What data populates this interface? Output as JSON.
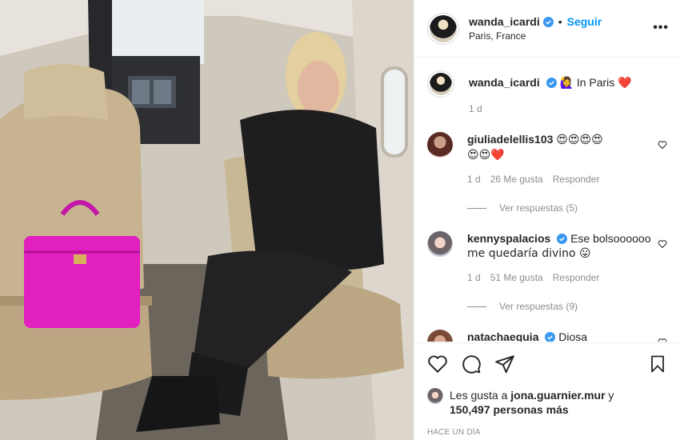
{
  "post": {
    "author": "wanda_icardi",
    "follow_label": "Seguir",
    "location": "Paris, France",
    "more_icon": "more-options-icon",
    "separator": "•"
  },
  "caption": {
    "username": "wanda_icardi",
    "emoji": "🙋‍♀️",
    "text": "In Paris",
    "heart": "❤️",
    "age": "1 d"
  },
  "comments": [
    {
      "username": "giuliadelellis103",
      "verified": false,
      "text": "😍😍😍😍",
      "text2": "😍😍❤️",
      "age": "1 d",
      "likes": "26 Me gusta",
      "reply": "Responder",
      "view_replies": "Ver respuestas (5)"
    },
    {
      "username": "kennyspalacios",
      "verified": true,
      "text": "Ese bolsoooooo",
      "text2": "me quedaría divino 😛",
      "age": "1 d",
      "likes": "51 Me gusta",
      "reply": "Responder",
      "view_replies": "Ver respuestas (9)"
    },
    {
      "username": "natachaeguia",
      "verified": true,
      "text": "Diosa"
    }
  ],
  "likes": {
    "prefix": "Les gusta a",
    "user": "jona.guarnier.mur",
    "and": "y",
    "count": "150,497 personas más"
  },
  "timestamp": "HACE UN DÍA",
  "colors": {
    "accent": "#0095f6",
    "verified": "#3897f0",
    "muted": "#8e8e8e",
    "bag": "#e21fbf"
  }
}
